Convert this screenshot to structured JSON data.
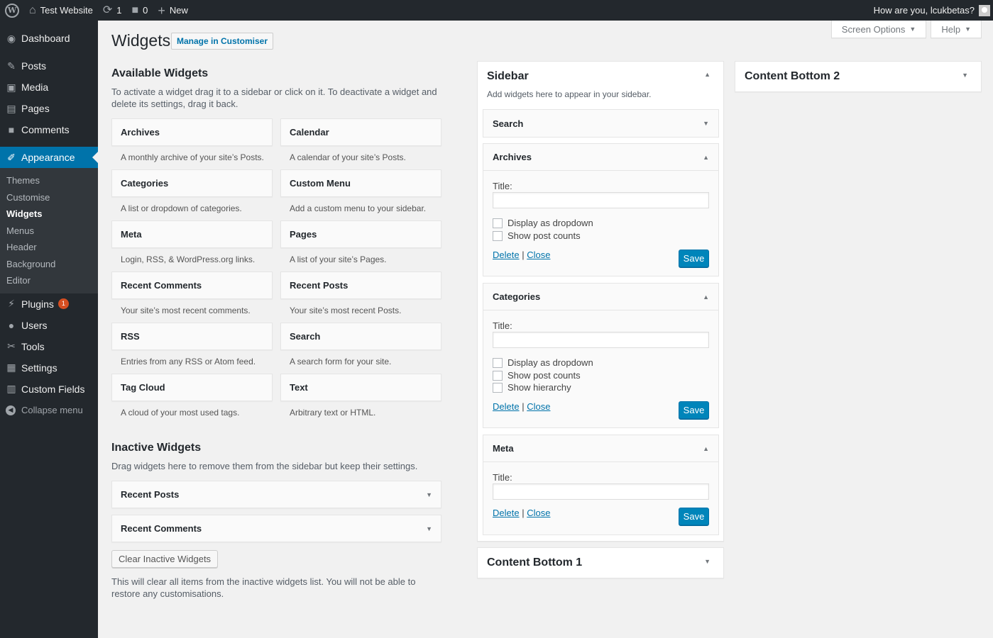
{
  "adminbar": {
    "site_name": "Test Website",
    "updates_count": "1",
    "comments_count": "0",
    "new_label": "New",
    "greeting": "How are you, lcukbetas?"
  },
  "menu": {
    "dashboard": "Dashboard",
    "posts": "Posts",
    "media": "Media",
    "pages": "Pages",
    "comments": "Comments",
    "appearance": "Appearance",
    "appearance_sub": [
      "Themes",
      "Customise",
      "Widgets",
      "Menus",
      "Header",
      "Background",
      "Editor"
    ],
    "plugins": "Plugins",
    "plugins_badge": "1",
    "users": "Users",
    "tools": "Tools",
    "settings": "Settings",
    "custom_fields": "Custom Fields",
    "collapse": "Collapse menu"
  },
  "screen_meta": {
    "screen_options": "Screen Options",
    "help": "Help"
  },
  "page": {
    "title": "Widgets",
    "action": "Manage in Customiser"
  },
  "available": {
    "heading": "Available Widgets",
    "description": "To activate a widget drag it to a sidebar or click on it. To deactivate a widget and delete its settings, drag it back.",
    "widgets": [
      {
        "name": "Archives",
        "desc": "A monthly archive of your site’s Posts."
      },
      {
        "name": "Calendar",
        "desc": "A calendar of your site’s Posts."
      },
      {
        "name": "Categories",
        "desc": "A list or dropdown of categories."
      },
      {
        "name": "Custom Menu",
        "desc": "Add a custom menu to your sidebar."
      },
      {
        "name": "Meta",
        "desc": "Login, RSS, & WordPress.org links."
      },
      {
        "name": "Pages",
        "desc": "A list of your site’s Pages."
      },
      {
        "name": "Recent Comments",
        "desc": "Your site’s most recent comments."
      },
      {
        "name": "Recent Posts",
        "desc": "Your site’s most recent Posts."
      },
      {
        "name": "RSS",
        "desc": "Entries from any RSS or Atom feed."
      },
      {
        "name": "Search",
        "desc": "A search form for your site."
      },
      {
        "name": "Tag Cloud",
        "desc": "A cloud of your most used tags."
      },
      {
        "name": "Text",
        "desc": "Arbitrary text or HTML."
      }
    ]
  },
  "inactive": {
    "heading": "Inactive Widgets",
    "description": "Drag widgets here to remove them from the sidebar but keep their settings.",
    "widgets": [
      "Recent Posts",
      "Recent Comments"
    ],
    "clear_button": "Clear Inactive Widgets",
    "clear_note": "This will clear all items from the inactive widgets list. You will not be able to restore any customisations."
  },
  "sidebar_area": {
    "title": "Sidebar",
    "description": "Add widgets here to appear in your sidebar.",
    "search": {
      "name": "Search"
    },
    "archives": {
      "name": "Archives",
      "title_label": "Title:",
      "title_value": "",
      "options": [
        "Display as dropdown",
        "Show post counts"
      ],
      "delete": "Delete",
      "sep": "|",
      "close": "Close",
      "save": "Save"
    },
    "categories": {
      "name": "Categories",
      "title_label": "Title:",
      "title_value": "",
      "options": [
        "Display as dropdown",
        "Show post counts",
        "Show hierarchy"
      ],
      "delete": "Delete",
      "sep": "|",
      "close": "Close",
      "save": "Save"
    },
    "meta": {
      "name": "Meta",
      "title_label": "Title:",
      "title_value": "",
      "delete": "Delete",
      "sep": "|",
      "close": "Close",
      "save": "Save"
    }
  },
  "content_bottom_1": {
    "title": "Content Bottom 1"
  },
  "content_bottom_2": {
    "title": "Content Bottom 2"
  },
  "icons": {
    "down": "▼",
    "up": "▲"
  }
}
